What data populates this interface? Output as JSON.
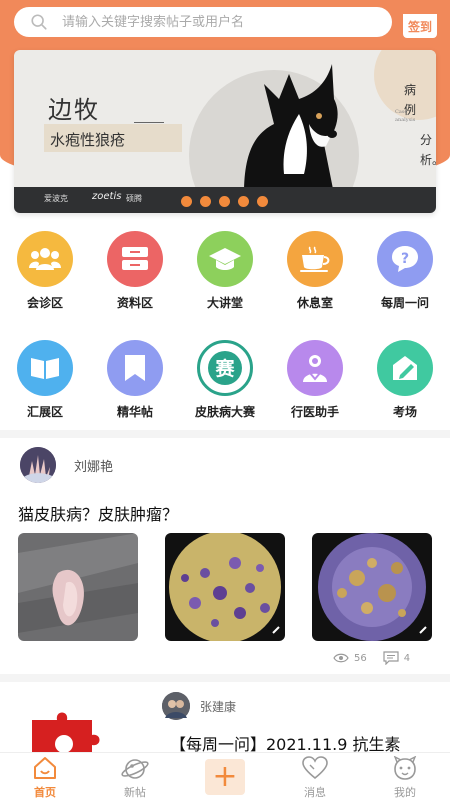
{
  "search": {
    "placeholder": "请输入关键字搜索帖子或用户名"
  },
  "signin": {
    "label": "签到"
  },
  "banner": {
    "title": "边牧",
    "subtitle": "水疱性狼疮",
    "side_text_1": "病例",
    "side_text_2": "分析。",
    "side_tiny": "Case analysis",
    "brand_1": "爱波克",
    "brand_2": "zoetis",
    "brand_3": "硕腾",
    "page_count": 5
  },
  "menu_row1": [
    {
      "label": "会诊区",
      "icon": "people-icon",
      "color": "#f5b93f"
    },
    {
      "label": "资料区",
      "icon": "drawer-icon",
      "color": "#ec6565"
    },
    {
      "label": "大讲堂",
      "icon": "graduation-cap-icon",
      "color": "#8dd05c"
    },
    {
      "label": "休息室",
      "icon": "coffee-cup-icon",
      "color": "#f4a53f"
    },
    {
      "label": "每周一问",
      "icon": "question-bubble-icon",
      "color": "#8f9cf1"
    }
  ],
  "menu_row2": [
    {
      "label": "汇展区",
      "icon": "book-icon",
      "color": "#4fb1ee"
    },
    {
      "label": "精华帖",
      "icon": "bookmark-icon",
      "color": "#8f9cf1"
    },
    {
      "label": "皮肤病大赛",
      "icon": "competition-badge-icon",
      "color": "#2aa38a"
    },
    {
      "label": "行医助手",
      "icon": "doctor-icon",
      "color": "#b889ec"
    },
    {
      "label": "考场",
      "icon": "exam-icon",
      "color": "#40c9a0"
    }
  ],
  "post1": {
    "author": "刘娜艳",
    "title": "猫皮肤病？皮肤肿瘤？",
    "views": "56",
    "comments": "4"
  },
  "post2": {
    "author": "张建康",
    "title": "【每周一问】2021.11.9 抗生素"
  },
  "nav": [
    {
      "label": "首页",
      "icon": "home-icon",
      "active": true
    },
    {
      "label": "新帖",
      "icon": "planet-icon",
      "active": false
    },
    {
      "label": "",
      "icon": "plus-icon",
      "active": false
    },
    {
      "label": "消息",
      "icon": "heart-icon",
      "active": false
    },
    {
      "label": "我的",
      "icon": "smiley-icon",
      "active": false
    }
  ],
  "colors": {
    "accent": "#f28a3c",
    "header": "#f1895a"
  }
}
